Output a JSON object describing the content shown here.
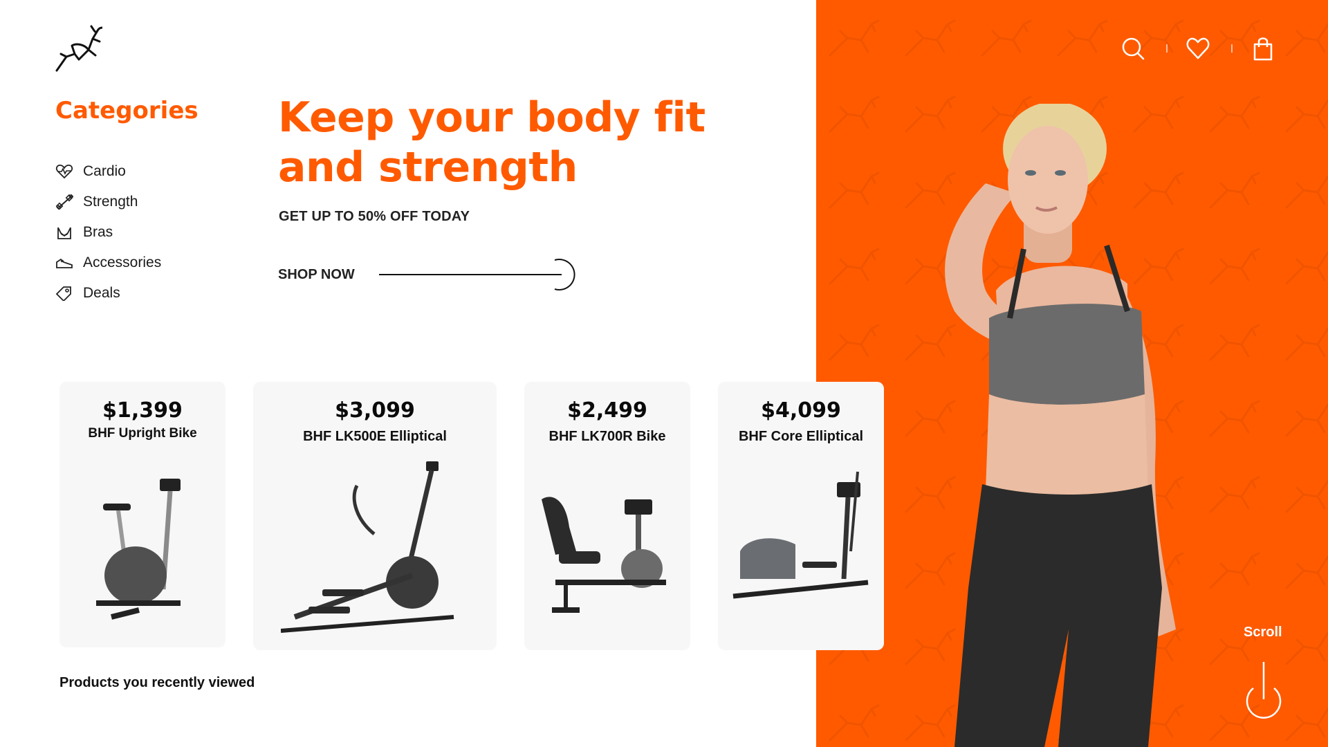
{
  "brand": {
    "logo": "gazelle-logo"
  },
  "categories": {
    "title": "Categories",
    "items": [
      {
        "label": "Cardio",
        "icon": "heartbeat-icon"
      },
      {
        "label": "Strength",
        "icon": "dumbbell-icon"
      },
      {
        "label": "Bras",
        "icon": "sports-bra-icon"
      },
      {
        "label": "Accessories",
        "icon": "sneaker-icon"
      },
      {
        "label": "Deals",
        "icon": "tag-icon"
      }
    ]
  },
  "hero": {
    "title_line1": "Keep your body fit",
    "title_line2": "and strength",
    "subtitle": "GET UP TO 50% OFF TODAY",
    "cta_label": "SHOP NOW"
  },
  "header": {
    "icons": [
      "search-icon",
      "heart-icon",
      "shopping-bag-icon"
    ]
  },
  "products": [
    {
      "price": "$1,399",
      "name": "BHF Upright Bike"
    },
    {
      "price": "$3,099",
      "name": "BHF LK500E Elliptical"
    },
    {
      "price": "$2,499",
      "name": "BHF LK700R Bike"
    },
    {
      "price": "$4,099",
      "name": "BHF Core Elliptical"
    }
  ],
  "recent_label": "Products you recently viewed",
  "scroll_label": "Scroll",
  "colors": {
    "accent": "#ff5a00",
    "card_bg": "#f7f7f7",
    "text": "#111111"
  }
}
